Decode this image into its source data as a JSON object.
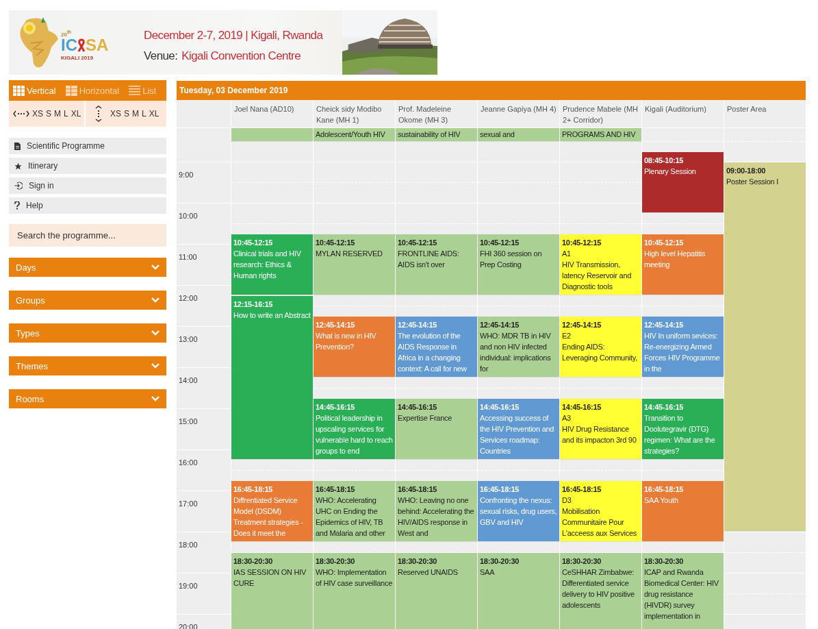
{
  "banner": {
    "logo_ordinal": "20$^{th}$",
    "logo_left": "IC",
    "logo_right": "SA",
    "logo_city": "KIGALI 2019",
    "dates": "December 2-7, 2019 | Kigali, Rwanda",
    "venue_label": "Venue:",
    "venue": "Kigali Convention Centre"
  },
  "views": [
    {
      "label": "Vertical",
      "kind": "columns",
      "selected": true
    },
    {
      "label": "Horizontal",
      "kind": "rows",
      "selected": false
    },
    {
      "label": "List",
      "kind": "list",
      "selected": false
    }
  ],
  "zoom": [
    {
      "kind": "horizontal",
      "sizes": [
        "XS",
        "S",
        "M",
        "L",
        "XL"
      ]
    },
    {
      "kind": "vertical",
      "sizes": [
        "XS",
        "S",
        "M",
        "L",
        "XL"
      ]
    }
  ],
  "menu": [
    {
      "label": "Scientific Programme",
      "kind": "document"
    },
    {
      "label": "Itinerary",
      "kind": "star"
    },
    {
      "label": "Sign in",
      "kind": "sign-in"
    },
    {
      "label": "Help",
      "kind": "help"
    }
  ],
  "search": {
    "placeholder": "Search the programme..."
  },
  "filters": [
    "Days",
    "Groups",
    "Types",
    "Themes",
    "Rooms"
  ],
  "calendar": {
    "date": "Tuesday, 03 December 2019",
    "times": [
      "9:00",
      "10:00",
      "11:00",
      "12:00",
      "13:00",
      "14:00",
      "15:00",
      "16:00",
      "17:00",
      "18:00",
      "19:00",
      "20:00"
    ],
    "rooms": [
      {
        "name": "Joel Nana (AD10)",
        "sessions": [
          {
            "kind": "continued",
            "color": "#abd093"
          },
          {
            "kind": "session",
            "time": "10:45-12:15",
            "title": "Clinical trials and HIV research: Ethics & Human rights",
            "color": "#2aaf56"
          },
          {
            "kind": "session",
            "time": "12:15-16:15",
            "title": "How to write an Abstract",
            "color": "#2aaf56"
          },
          {
            "kind": "session",
            "time": "16:45-18:15",
            "title": "Diffrentiated Service Model (DSDM) Treatment strategies - Does it meet the",
            "color": "#e87b35"
          },
          {
            "kind": "session",
            "time": "18:30-20:30",
            "title": "IAS SESSION ON HIV CURE",
            "color": "#abd093"
          }
        ]
      },
      {
        "name": "Cheick sidy Modibo Kane (MH 1)",
        "sessions": [
          {
            "kind": "continued",
            "title": "Adolescent/Youth HIV",
            "color": "#abd093"
          },
          {
            "kind": "session",
            "time": "10:45-12:15",
            "title": "MYLAN RESERVED",
            "color": "#abd093"
          },
          {
            "kind": "session",
            "time": "12:45-14:15",
            "title": "What is new in HIV Prevention?",
            "color": "#e87b35"
          },
          {
            "kind": "session",
            "time": "14:45-16:15",
            "title": "Political leadership in upscaling services for vulnerable hard to reach groups to end",
            "color": "#2aaf56"
          },
          {
            "kind": "session",
            "time": "16:45-18:15",
            "title": "WHO: Accelerating UHC on Ending the Epidemics of HIV, TB and Malaria and other",
            "color": "#abd093"
          },
          {
            "kind": "session",
            "time": "18:30-20:30",
            "title": "WHO: Implementation of HIV case surveillance",
            "color": "#abd093"
          }
        ]
      },
      {
        "name": "Prof. Madeleine Okome (MH 3)",
        "sessions": [
          {
            "kind": "continued",
            "title": "sustainability of HIV",
            "color": "#abd093"
          },
          {
            "kind": "session",
            "time": "10:45-12:15",
            "title": "FRONTLINE AIDS: AIDS isn't over",
            "color": "#abd093"
          },
          {
            "kind": "session",
            "time": "12:45-14:15",
            "title": "The evolution of the AIDS Response in Africa in a changing context: A call for new",
            "color": "#6199d2"
          },
          {
            "kind": "session",
            "time": "14:45-16:15",
            "title": "Expertise France",
            "color": "#abd093"
          },
          {
            "kind": "session",
            "time": "16:45-18:15",
            "title": "WHO: Leaving no one behind: Accelerating the HIV/AIDS response in West and",
            "color": "#abd093"
          },
          {
            "kind": "session",
            "time": "18:30-20:30",
            "title": "Reserved UNAIDS",
            "color": "#abd093"
          }
        ]
      },
      {
        "name": "Jeanne Gapiya (MH 4)",
        "sessions": [
          {
            "kind": "continued",
            "title": "sexual and",
            "color": "#abd093"
          },
          {
            "kind": "session",
            "time": "10:45-12:15",
            "title": "FHI 360 session on Prep Costing",
            "color": "#abd093"
          },
          {
            "kind": "session",
            "time": "12:45-14:15",
            "title": "WHO: MDR TB in HIV and non HIV infected individual: implications for",
            "color": "#abd093"
          },
          {
            "kind": "session",
            "time": "14:45-16:15",
            "title": "Accessing success of the HIV Prevention and Services roadmap: Countries",
            "color": "#6199d2"
          },
          {
            "kind": "session",
            "time": "16:45-18:15",
            "title": "Confronting the nexus: sexual risks, drug users, GBV and HIV",
            "color": "#6199d2"
          },
          {
            "kind": "session",
            "time": "18:30-20:30",
            "title": "SAA",
            "color": "#abd093"
          }
        ]
      },
      {
        "name": "Prudence Mabele (MH 2+ Corridor)",
        "sessions": [
          {
            "kind": "continued",
            "title": "PROGRAMS AND HIV",
            "color": "#abd093"
          },
          {
            "kind": "session",
            "time": "10:45-12:15",
            "code": "A1",
            "title": "HIV Transmission, latency Reservoir and Diagnostic tools",
            "color": "#ffff33"
          },
          {
            "kind": "session",
            "time": "12:45-14:15",
            "code": "E2",
            "title": "Ending AIDS: Leveraging Community,",
            "color": "#ffff33"
          },
          {
            "kind": "session",
            "time": "14:45-16:15",
            "code": "A3",
            "title": "HIV Drug Resistance and its impacton 3rd 90",
            "color": "#ffff33"
          },
          {
            "kind": "session",
            "time": "16:45-18:15",
            "code": "D3",
            "title": "Mobilisation Communitaire Pour L'acceess aux Services",
            "color": "#ffff33"
          },
          {
            "kind": "session",
            "time": "18:30-20:30",
            "title": "CeSHHAR Zimbabwe: Differentiated service delivery to HIV positive adolescents",
            "color": "#abd093"
          }
        ]
      },
      {
        "name": "Kigali (Auditorium)",
        "sessions": [
          {
            "kind": "session",
            "time": "08:45-10:15",
            "title": "Plenary Session",
            "color": "#ad2b2b"
          },
          {
            "kind": "session",
            "time": "10:45-12:15",
            "title": "High level Hepatitis meeting",
            "color": "#e87b35"
          },
          {
            "kind": "session",
            "time": "12:45-14:15",
            "title": "HIV In uniform sevices: Re-energizing Armed Forces HIV Programme in the",
            "color": "#6199d2"
          },
          {
            "kind": "session",
            "time": "14:45-16:15",
            "title": "Transition to Doolutegravir (DTG) regimen: What are the strategies?",
            "color": "#2aaf56"
          },
          {
            "kind": "session",
            "time": "16:45-18:15",
            "title": "SAA Youth",
            "color": "#e87b35"
          },
          {
            "kind": "session",
            "time": "18:30-20:30",
            "title": "ICAP and Rwanda Biomedical Center: HIV drug resistance (HIVDR) survey implementation in",
            "color": "#abd093"
          }
        ]
      },
      {
        "name": "Poster Area",
        "sessions": [
          {
            "kind": "session",
            "time": "09:00-18:00",
            "title": "Poster Session I",
            "color": "#d3d38f"
          }
        ]
      }
    ]
  }
}
